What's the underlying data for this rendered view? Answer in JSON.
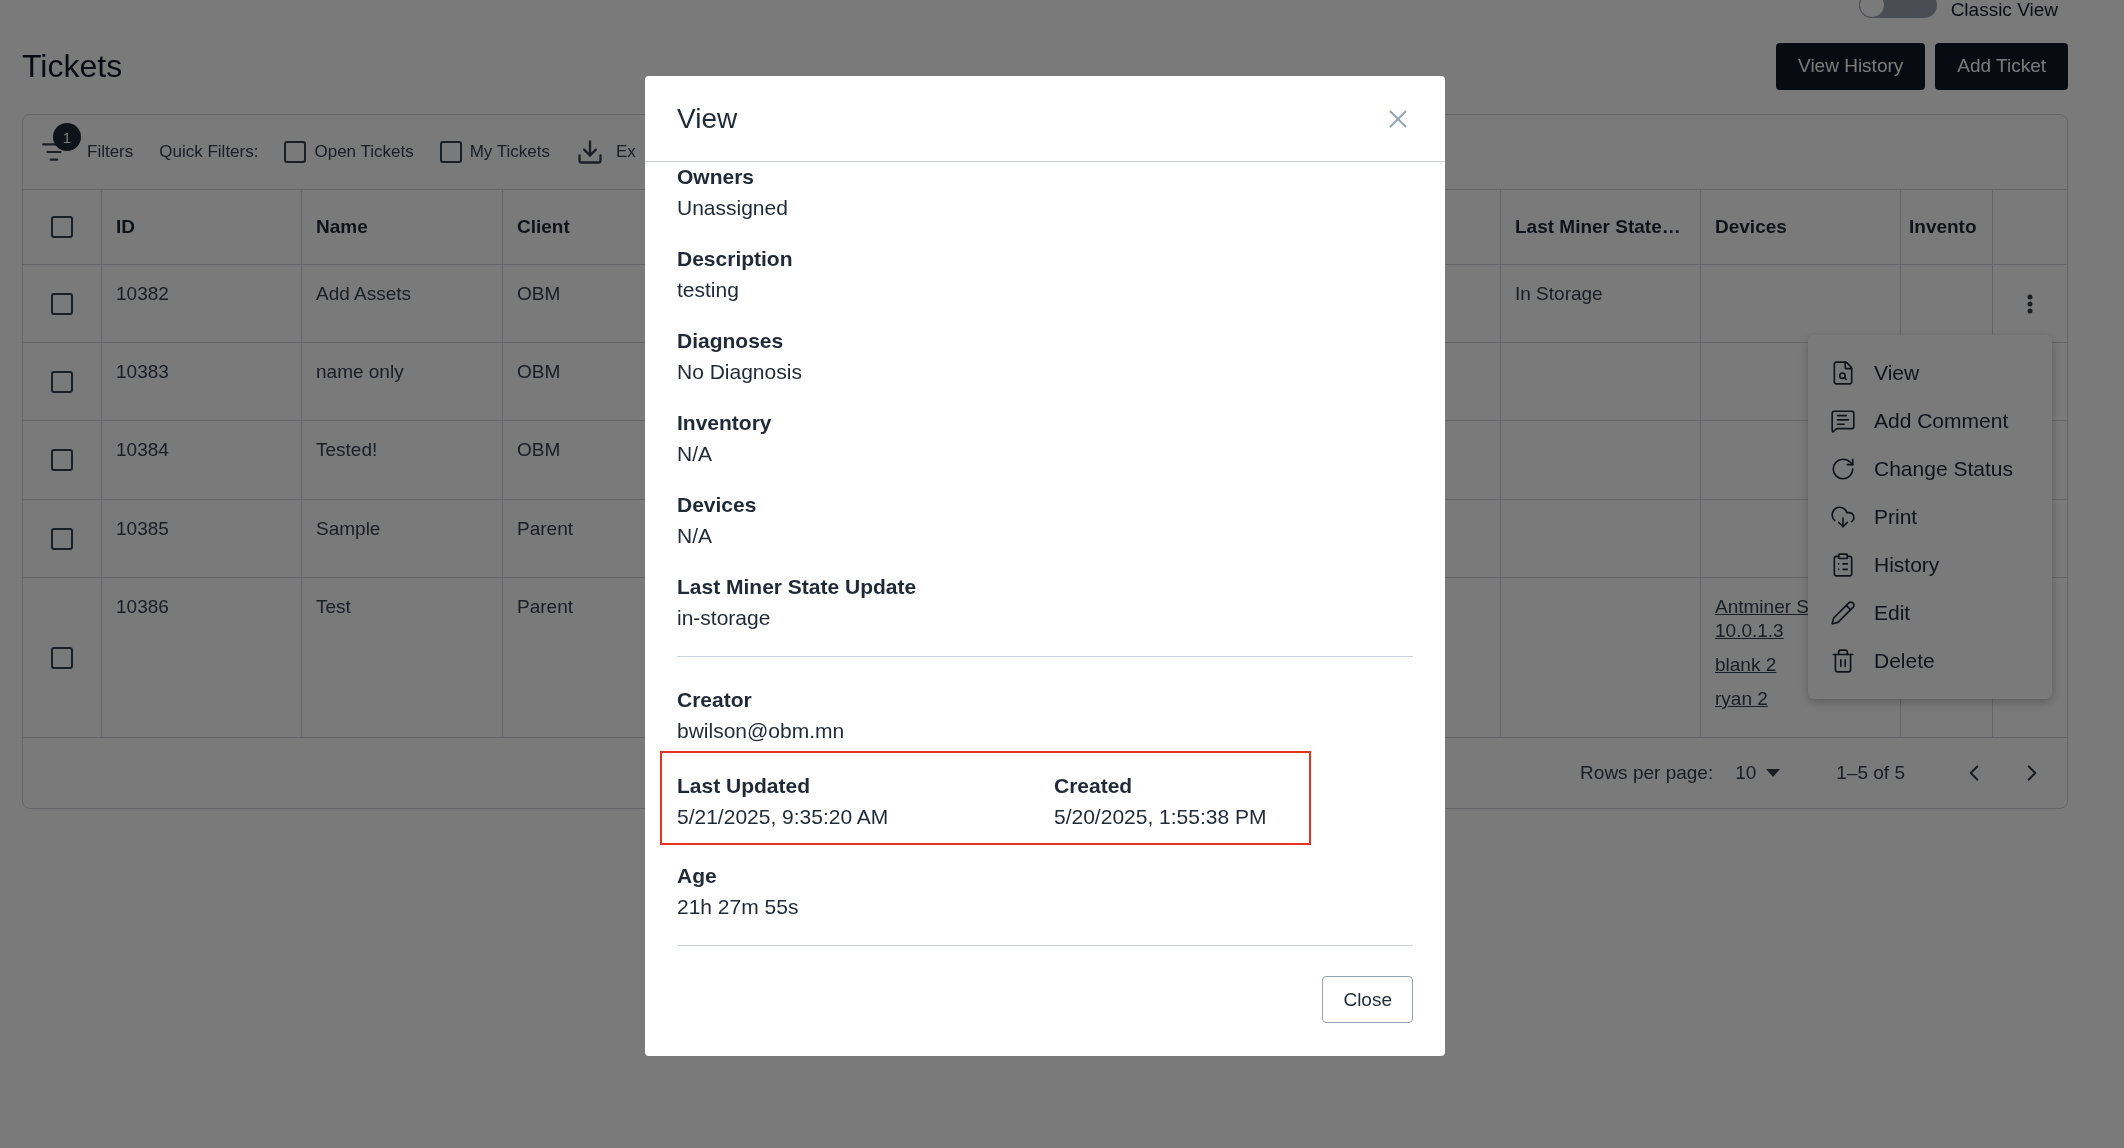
{
  "classic_view": {
    "label": "Classic View",
    "on": false
  },
  "page_title": "Tickets",
  "header_buttons": [
    "View History",
    "Add Ticket"
  ],
  "toolbar": {
    "filters_label": "Filters",
    "filters_count": "1",
    "quick_filters_label": "Quick Filters:",
    "quick_filters": [
      {
        "label": "Open Tickets",
        "checked": false
      },
      {
        "label": "My Tickets",
        "checked": false
      }
    ],
    "export_label": "Ex"
  },
  "table": {
    "select_all_checked": false,
    "columns": [
      "ID",
      "Name",
      "Client",
      "Last Miner State…",
      "Devices",
      "Invento"
    ],
    "rows": [
      {
        "selected": false,
        "id": "10382",
        "name": "Add Assets",
        "client": "OBM",
        "last_miner_state": "In Storage",
        "devices": []
      },
      {
        "selected": false,
        "id": "10383",
        "name": "name only",
        "client": "OBM",
        "last_miner_state": "",
        "devices": []
      },
      {
        "selected": false,
        "id": "10384",
        "name": "Tested!",
        "client": "OBM",
        "last_miner_state": "",
        "devices": []
      },
      {
        "selected": false,
        "id": "10385",
        "name": "Sample",
        "client": "Parent",
        "last_miner_state": "",
        "devices": []
      },
      {
        "selected": false,
        "id": "10386",
        "name": "Test",
        "client": "Parent",
        "last_miner_state": "",
        "devices": [
          [
            "Antminer S",
            "10.0.1.3"
          ],
          [
            "blank 2"
          ],
          [
            "ryan 2"
          ]
        ]
      }
    ],
    "footer": {
      "rows_per_page_label": "Rows per page:",
      "rows_per_page": "10",
      "range": "1–5 of 5"
    }
  },
  "row_menu": [
    "View",
    "Add Comment",
    "Change Status",
    "Print",
    "History",
    "Edit",
    "Delete"
  ],
  "modal": {
    "title": "View",
    "fields": [
      {
        "label": "Owners",
        "value": "Unassigned"
      },
      {
        "label": "Description",
        "value": "testing"
      },
      {
        "label": "Diagnoses",
        "value": "No Diagnosis"
      },
      {
        "label": "Inventory",
        "value": "N/A"
      },
      {
        "label": "Devices",
        "value": "N/A"
      },
      {
        "label": "Last Miner State Update",
        "value": "in-storage"
      }
    ],
    "creator": {
      "label": "Creator",
      "value": "bwilson@obm.mn"
    },
    "timestamps": [
      {
        "label": "Last Updated",
        "value": "5/21/2025, 9:35:20 AM"
      },
      {
        "label": "Created",
        "value": "5/20/2025, 1:55:38 PM"
      }
    ],
    "age": {
      "label": "Age",
      "value": "21h 27m 55s"
    },
    "close_button": "Close"
  }
}
